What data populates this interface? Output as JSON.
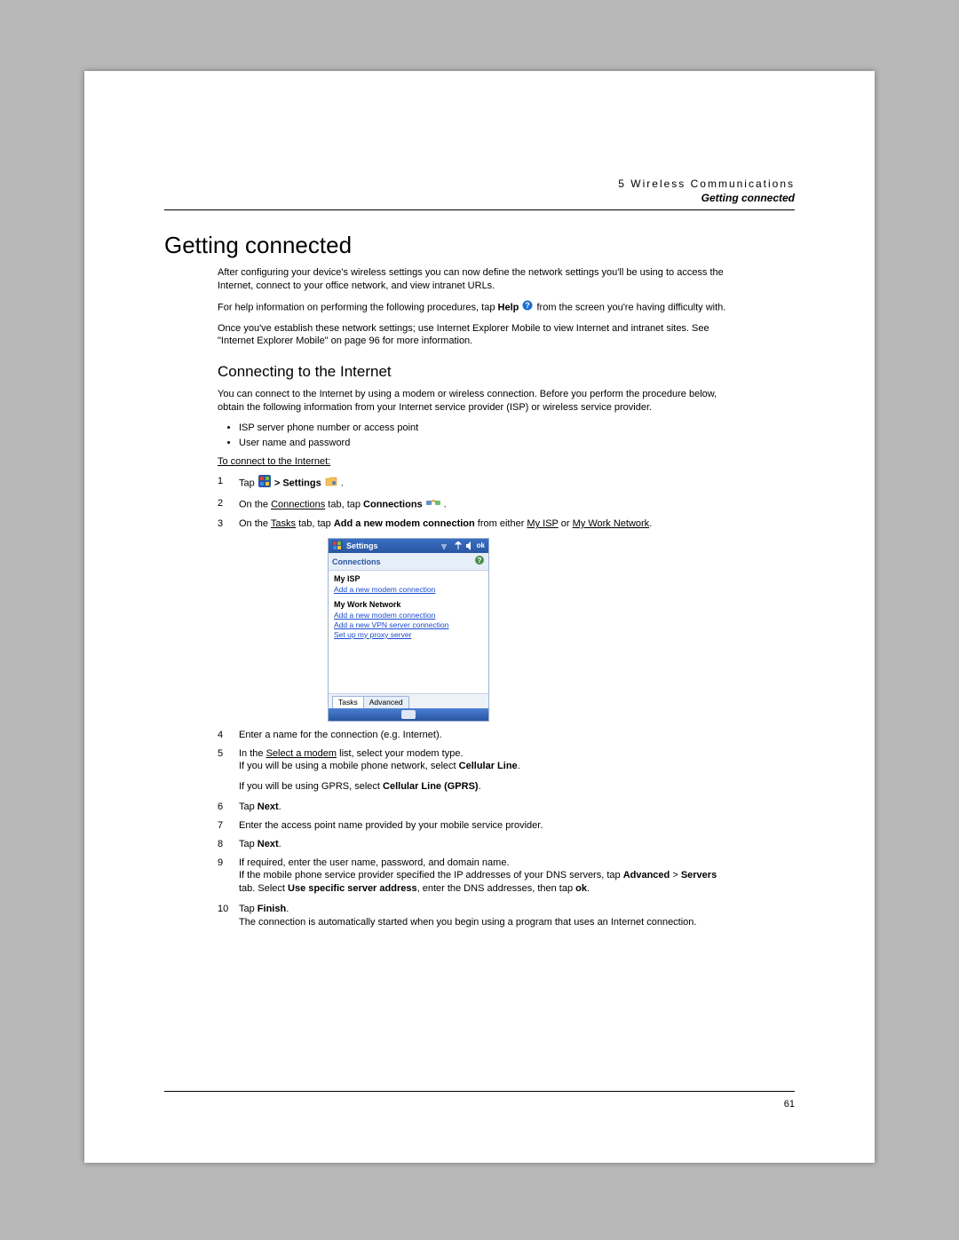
{
  "header": {
    "chapter_line": "5 Wireless Communications",
    "subtitle": "Getting connected"
  },
  "section_title": "Getting connected",
  "intro": {
    "p1": "After configuring your device's wireless settings you can now define the network settings you'll be using to access the Internet, connect to your office network, and view intranet URLs.",
    "p2a": "For help information on performing the following procedures, tap ",
    "p2b": "Help",
    "p2c": " from the screen you're having difficulty with.",
    "p3": "Once you've establish these network settings; use Internet Explorer Mobile to view Internet and intranet sites. See \"Internet Explorer Mobile\" on page 96 for more information."
  },
  "subsection_title": "Connecting to the Internet",
  "sub_intro": "You can connect to the Internet by using a modem or wireless connection. Before you perform the procedure below, obtain the following information from your Internet service provider (ISP) or wireless service provider.",
  "bullets": [
    "ISP server phone number or access point",
    "User name and password"
  ],
  "proc_title": "To connect to the Internet:",
  "steps": {
    "s1a": "Tap ",
    "s1b": " > ",
    "s1c": "Settings",
    "s1d": ".",
    "s2a": "On the ",
    "s2b": "Connections",
    "s2c": " tab, tap ",
    "s2d": "Connections",
    "s2e": ".",
    "s3a": "On the ",
    "s3b": "Tasks",
    "s3c": " tab, tap ",
    "s3d": "Add a new modem connection",
    "s3e": " from either ",
    "s3f": "My ISP",
    "s3g": " or ",
    "s3h": "My Work Network",
    "s3i": ".",
    "s4": "Enter a name for the connection (e.g. Internet).",
    "s5a": "In the ",
    "s5b": "Select a modem",
    "s5c": " list, select your modem type.",
    "s5n1a": "If you will be using a mobile phone network, select ",
    "s5n1b": "Cellular Line",
    "s5n1c": ".",
    "s5n2a": "If you will be using GPRS, select ",
    "s5n2b": "Cellular Line (GPRS)",
    "s5n2c": ".",
    "s6a": "Tap ",
    "s6b": "Next",
    "s6c": ".",
    "s7": "Enter the access point name provided by your mobile service provider.",
    "s8a": "Tap ",
    "s8b": "Next",
    "s8c": ".",
    "s9": "If required, enter the user name, password, and domain name.",
    "s9na": "If the mobile phone service provider specified the IP addresses of your DNS servers, tap ",
    "s9nb": "Advanced",
    "s9nc": " > ",
    "s9nd": "Servers",
    "s9ne": " tab. Select ",
    "s9nf": "Use specific server address",
    "s9ng": ", enter the DNS addresses, then tap ",
    "s9nh": "ok",
    "s9ni": ".",
    "s10a": "Tap ",
    "s10b": "Finish",
    "s10c": ".",
    "s10n": "The connection is automatically started when you begin using a program that uses an Internet connection."
  },
  "mini_screen": {
    "title": "Settings",
    "bar": "Connections",
    "myisp_label": "My ISP",
    "myisp_link": "Add a new modem connection",
    "mynet_label": "My Work Network",
    "mynet_link1": "Add a new modem connection",
    "mynet_link2": "Add a new VPN server connection",
    "mynet_link3": "Set up my proxy server",
    "tab1": "Tasks",
    "tab2": "Advanced",
    "ok": "ok"
  },
  "page_number": "61"
}
